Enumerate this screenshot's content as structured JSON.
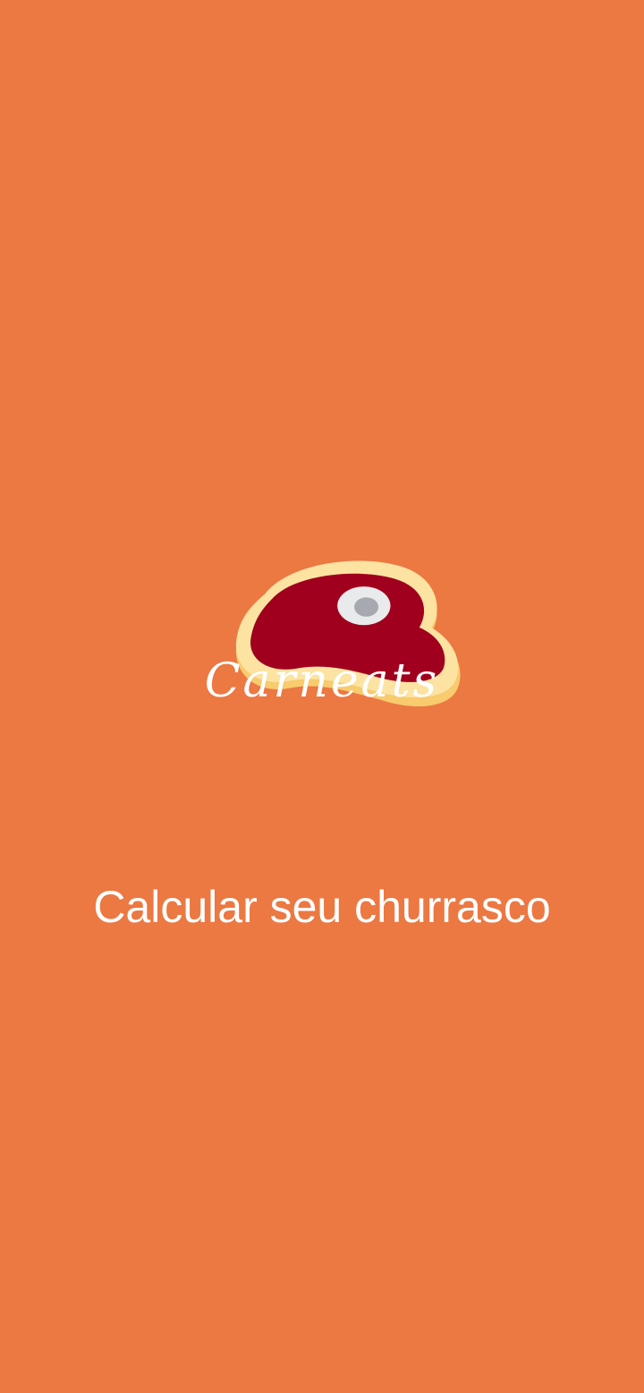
{
  "app": {
    "logo": {
      "icon": "steak-icon",
      "wordmark": "Carneats"
    },
    "actions": {
      "calculate_label": "Calcular seu churrasco"
    },
    "colors": {
      "background": "#EC7842",
      "text": "#FFFFFF",
      "meat": "#A0001E",
      "fat": "#FCE3A2",
      "fat_shadow": "#F7CB6E",
      "bone": "#E9EAEC",
      "bone_center": "#A6A9B0"
    }
  }
}
